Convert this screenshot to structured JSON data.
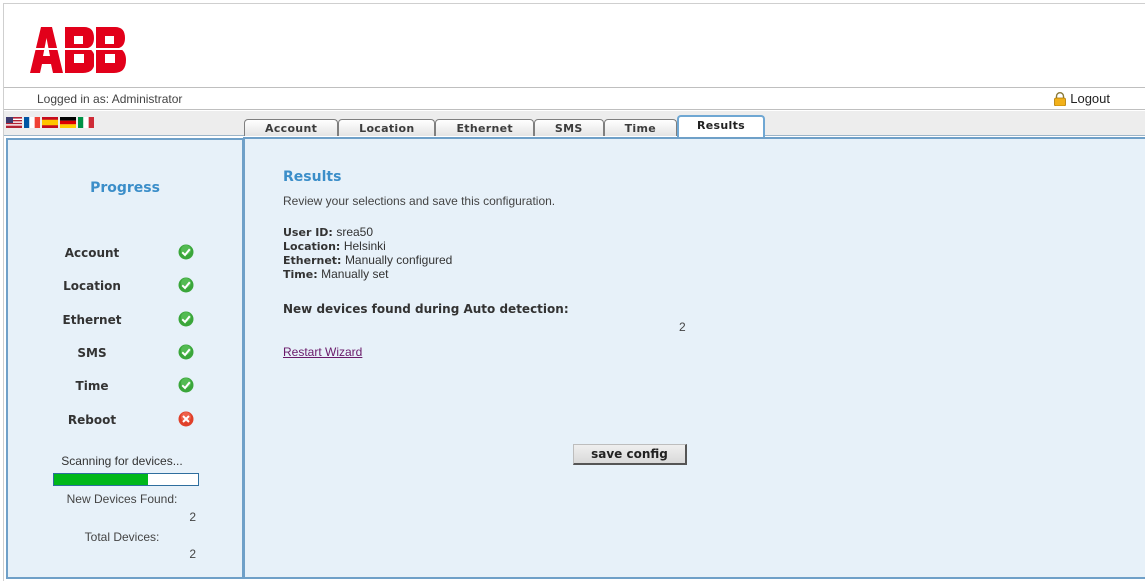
{
  "header": {
    "logo_text": "ABB",
    "logged_in_text": "Logged in as: Administrator",
    "logout_label": "Logout"
  },
  "languages": [
    {
      "name": "English",
      "icon": "flag-us-icon"
    },
    {
      "name": "French",
      "icon": "flag-fr-icon"
    },
    {
      "name": "Spanish",
      "icon": "flag-es-icon"
    },
    {
      "name": "German",
      "icon": "flag-de-icon"
    },
    {
      "name": "Italian",
      "icon": "flag-it-icon"
    }
  ],
  "tabs": [
    {
      "label": "Account",
      "active": false
    },
    {
      "label": "Location",
      "active": false
    },
    {
      "label": "Ethernet",
      "active": false
    },
    {
      "label": "SMS",
      "active": false
    },
    {
      "label": "Time",
      "active": false
    },
    {
      "label": "Results",
      "active": true
    }
  ],
  "progress": {
    "title": "Progress",
    "steps": [
      {
        "label": "Account",
        "status": "done",
        "icon": "check-icon"
      },
      {
        "label": "Location",
        "status": "done",
        "icon": "check-icon"
      },
      {
        "label": "Ethernet",
        "status": "done",
        "icon": "check-icon"
      },
      {
        "label": "SMS",
        "status": "done",
        "icon": "check-icon"
      },
      {
        "label": "Time",
        "status": "done",
        "icon": "check-icon"
      },
      {
        "label": "Reboot",
        "status": "error",
        "icon": "error-icon"
      }
    ],
    "scanning_text": "Scanning for devices...",
    "scan_progress": 0.65,
    "new_devices_label": "New Devices Found:",
    "new_devices_value": "2",
    "total_devices_label": "Total Devices:",
    "total_devices_value": "2"
  },
  "results": {
    "title": "Results",
    "subtitle": "Review your selections and save this configuration.",
    "fields": [
      {
        "label": "User ID:",
        "value": "srea50"
      },
      {
        "label": "Location:",
        "value": "Helsinki"
      },
      {
        "label": "Ethernet:",
        "value": "Manually configured"
      },
      {
        "label": "Time:",
        "value": "Manually set"
      }
    ],
    "new_devices_heading": "New devices found during Auto detection:",
    "new_devices_count": "2",
    "restart_link": "Restart Wizard",
    "save_button": "save config"
  },
  "colors": {
    "brand_red": "#e2001a",
    "accent_blue": "#3b8ec9",
    "panel_bg": "#e7f1f9",
    "panel_border": "#6fa0c8",
    "progress_green": "#00b71a",
    "check_green": "#3aa63a",
    "error_red": "#e0402a"
  }
}
